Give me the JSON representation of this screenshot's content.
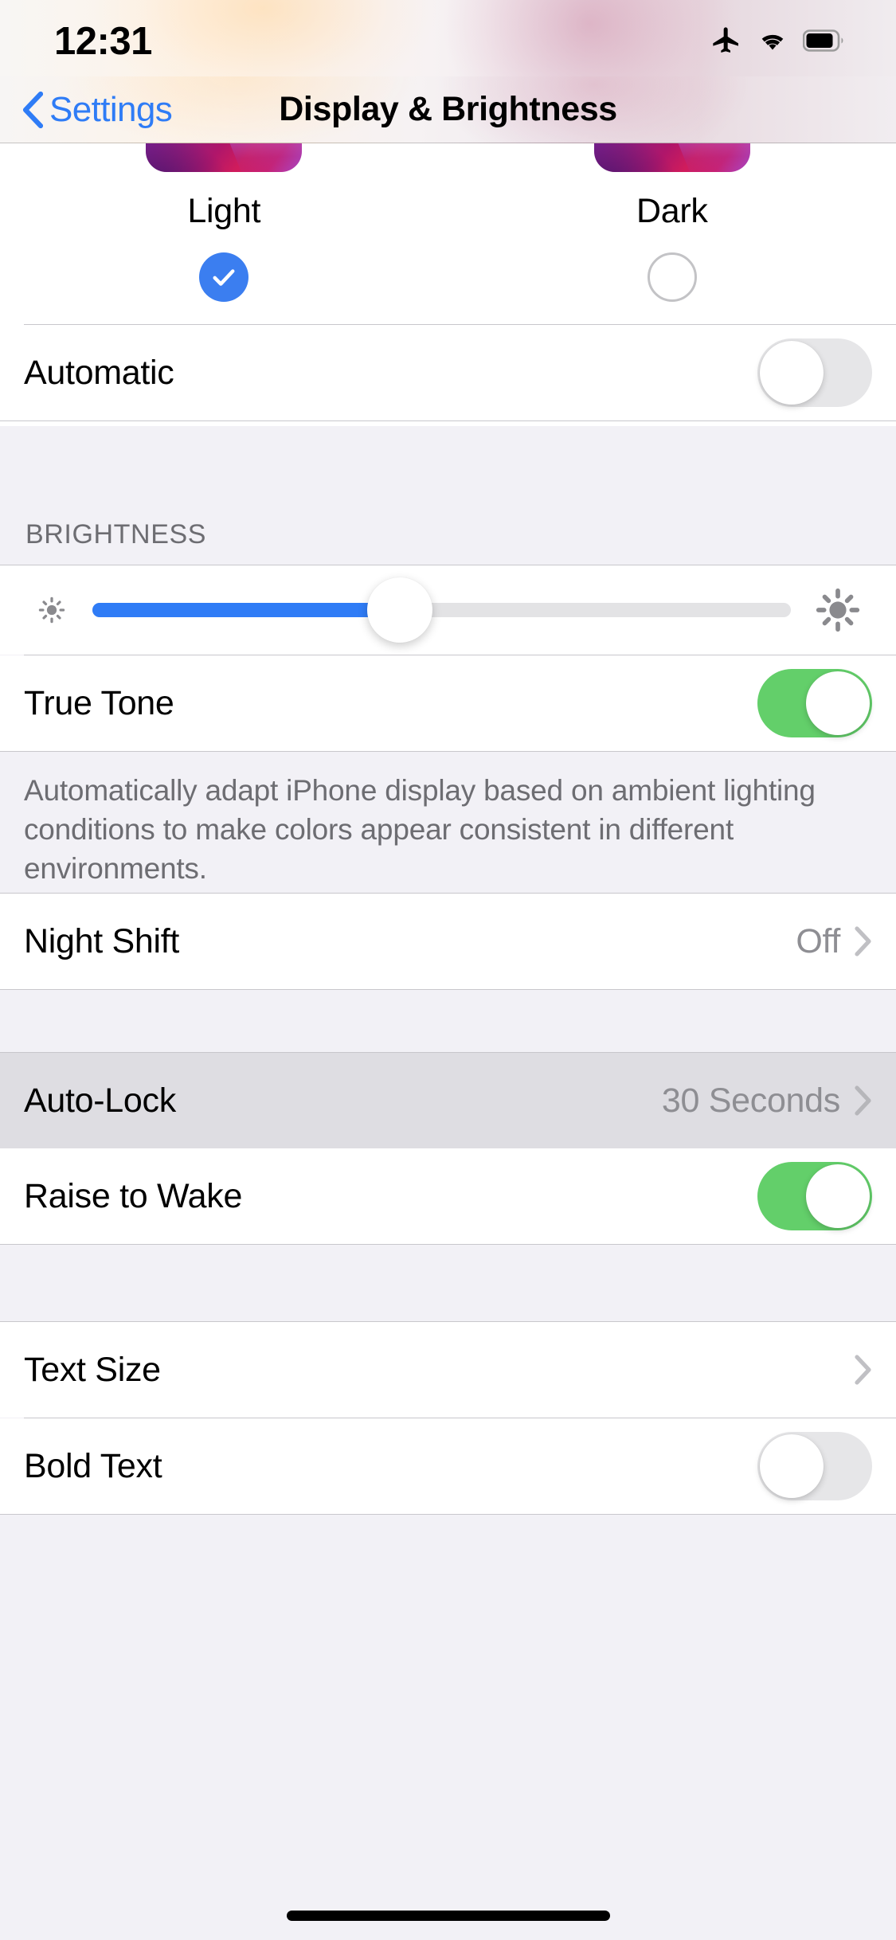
{
  "status_bar": {
    "time": "12:31",
    "icons": [
      "airplane-mode-icon",
      "wifi-icon",
      "battery-icon"
    ],
    "battery_level_pct": 80
  },
  "nav_bar": {
    "back_label": "Settings",
    "back_icon": "chevron-left-icon",
    "title": "Display & Brightness"
  },
  "appearance": {
    "options": [
      {
        "label": "Light",
        "selected": true
      },
      {
        "label": "Dark",
        "selected": false
      }
    ],
    "automatic": {
      "label": "Automatic",
      "toggle": "off"
    }
  },
  "brightness": {
    "header": "BRIGHTNESS",
    "slider": {
      "left_icon": "brightness-low-icon",
      "right_icon": "brightness-high-icon",
      "value_pct": 44
    },
    "true_tone": {
      "label": "True Tone",
      "toggle": "on"
    },
    "footer": "Automatically adapt iPhone display based on ambient lighting conditions to make colors appear consistent in different environments."
  },
  "night_shift": {
    "label": "Night Shift",
    "value": "Off",
    "accessory": "chevron-right-icon"
  },
  "lock_group": {
    "auto_lock": {
      "label": "Auto-Lock",
      "value": "30 Seconds",
      "accessory": "chevron-right-icon",
      "highlighted": true
    },
    "raise_to_wake": {
      "label": "Raise to Wake",
      "toggle": "on"
    }
  },
  "text_group": {
    "text_size": {
      "label": "Text Size",
      "accessory": "chevron-right-icon"
    },
    "bold_text": {
      "label": "Bold Text",
      "toggle": "off"
    }
  },
  "colors": {
    "accent_blue": "#2f7cf6",
    "toggle_on_green": "#63cf6a",
    "toggle_off_gray": "#e6e6e8",
    "group_background": "#f2f1f6",
    "row_background": "#ffffff",
    "secondary_text": "#8e8e93",
    "highlight_row": "#dedde2",
    "separator": "#c8c7cc"
  }
}
